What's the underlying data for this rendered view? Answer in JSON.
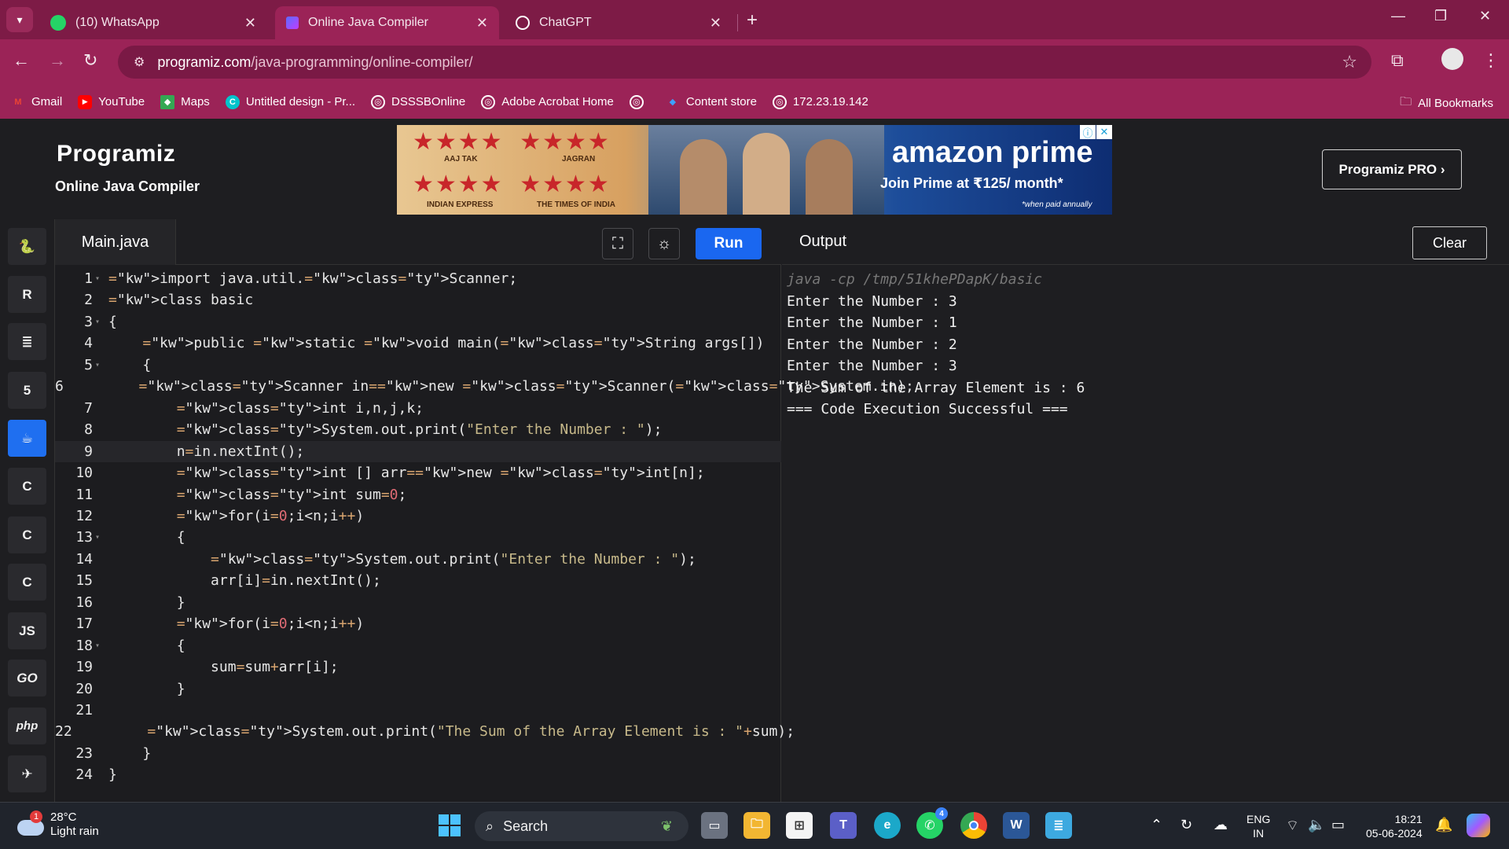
{
  "browser": {
    "tabs": [
      {
        "title": "(10) WhatsApp",
        "favicon": "whatsapp-icon",
        "active": false
      },
      {
        "title": "Online Java Compiler",
        "favicon": "programiz-icon",
        "active": true
      },
      {
        "title": "ChatGPT",
        "favicon": "chatgpt-icon",
        "active": false
      }
    ],
    "url_host": "programiz.com",
    "url_path": "/java-programming/online-compiler/",
    "bookmarks": [
      {
        "label": "Gmail",
        "icon": "gmail-icon",
        "color": "#ea4335"
      },
      {
        "label": "YouTube",
        "icon": "youtube-icon",
        "color": "#ff0000"
      },
      {
        "label": "Maps",
        "icon": "maps-icon",
        "color": "#34a853"
      },
      {
        "label": "Untitled design - Pr...",
        "icon": "canva-icon",
        "color": "#00c4cc"
      },
      {
        "label": "DSSSBOnline",
        "icon": "globe-icon",
        "color": "#ffffff"
      },
      {
        "label": "Adobe Acrobat Home",
        "icon": "globe-icon",
        "color": "#ffffff"
      },
      {
        "label": "",
        "icon": "globe-icon",
        "color": "#ffffff"
      },
      {
        "label": "Content store",
        "icon": "content-store-icon",
        "color": "#3ea0ff"
      },
      {
        "label": "172.23.19.142",
        "icon": "globe-icon",
        "color": "#ffffff"
      }
    ],
    "all_bookmarks": "All Bookmarks"
  },
  "header": {
    "logo": "Programiz",
    "subtitle": "Online Java Compiler",
    "pro_button": "Programiz PRO ›",
    "ad": {
      "ratings": [
        "AAJ TAK",
        "JAGRAN",
        "INDIAN EXPRESS",
        "THE TIMES OF INDIA"
      ],
      "brand": "amazon prime",
      "tagline": "Join Prime at ₹125/ month*",
      "footnote": "*when paid annually"
    }
  },
  "sidebar": {
    "languages": [
      {
        "name": "python",
        "glyph": "🐍",
        "active": false
      },
      {
        "name": "r",
        "glyph": "R",
        "active": false
      },
      {
        "name": "sql",
        "glyph": "≣",
        "active": false
      },
      {
        "name": "html",
        "glyph": "5",
        "active": false
      },
      {
        "name": "java",
        "glyph": "☕",
        "active": true
      },
      {
        "name": "c",
        "glyph": "C",
        "active": false
      },
      {
        "name": "cpp",
        "glyph": "C",
        "active": false
      },
      {
        "name": "csharp",
        "glyph": "C",
        "active": false
      },
      {
        "name": "javascript",
        "glyph": "JS",
        "active": false
      },
      {
        "name": "go",
        "glyph": "GO",
        "active": false
      },
      {
        "name": "php",
        "glyph": "php",
        "active": false
      },
      {
        "name": "swift",
        "glyph": "✈",
        "active": false
      }
    ]
  },
  "editor": {
    "file_name": "Main.java",
    "run_label": "Run",
    "highlighted_line": 9,
    "lines": [
      {
        "n": "1",
        "fold": true,
        "code": "import java.util.Scanner;"
      },
      {
        "n": "2",
        "fold": false,
        "code": "class basic"
      },
      {
        "n": "3",
        "fold": true,
        "code": "{"
      },
      {
        "n": "4",
        "fold": false,
        "code": "    public static void main(String args[])"
      },
      {
        "n": "5",
        "fold": true,
        "code": "    {"
      },
      {
        "n": "6",
        "fold": false,
        "code": "        Scanner in=new Scanner(System.in);"
      },
      {
        "n": "7",
        "fold": false,
        "code": "        int i,n,j,k;"
      },
      {
        "n": "8",
        "fold": false,
        "code": "        System.out.print(\"Enter the Number : \");"
      },
      {
        "n": "9",
        "fold": false,
        "code": "        n=in.nextInt();"
      },
      {
        "n": "10",
        "fold": false,
        "code": "        int [] arr=new int[n];"
      },
      {
        "n": "11",
        "fold": false,
        "code": "        int sum=0;"
      },
      {
        "n": "12",
        "fold": false,
        "code": "        for(i=0;i<n;i++)"
      },
      {
        "n": "13",
        "fold": true,
        "code": "        {"
      },
      {
        "n": "14",
        "fold": false,
        "code": "            System.out.print(\"Enter the Number : \");"
      },
      {
        "n": "15",
        "fold": false,
        "code": "            arr[i]=in.nextInt();"
      },
      {
        "n": "16",
        "fold": false,
        "code": "        }"
      },
      {
        "n": "17",
        "fold": false,
        "code": "        for(i=0;i<n;i++)"
      },
      {
        "n": "18",
        "fold": true,
        "code": "        {"
      },
      {
        "n": "19",
        "fold": false,
        "code": "            sum=sum+arr[i];"
      },
      {
        "n": "20",
        "fold": false,
        "code": "        }"
      },
      {
        "n": "21",
        "fold": false,
        "code": ""
      },
      {
        "n": "22",
        "fold": false,
        "code": "        System.out.print(\"The Sum of the Array Element is : \"+sum);"
      },
      {
        "n": "23",
        "fold": false,
        "code": "    }"
      },
      {
        "n": "24",
        "fold": false,
        "code": "}"
      }
    ]
  },
  "output": {
    "title": "Output",
    "clear_label": "Clear",
    "command": "java -cp /tmp/51khePDapK/basic",
    "lines": [
      "Enter the Number : 3",
      "Enter the Number : 1",
      "Enter the Number : 2",
      "Enter the Number : 3",
      "The Sum of the Array Element is : 6",
      "=== Code Execution Successful ==="
    ]
  },
  "taskbar": {
    "weather_temp": "28°C",
    "weather_desc": "Light rain",
    "weather_badge": "1",
    "search_label": "Search",
    "whatsapp_badge": "4",
    "lang_top": "ENG",
    "lang_bottom": "IN",
    "time": "18:21",
    "date": "05-06-2024"
  },
  "colors": {
    "browser_accent": "#9b2357",
    "run_button": "#1a67f0",
    "editor_bg": "#1c1c1f"
  }
}
